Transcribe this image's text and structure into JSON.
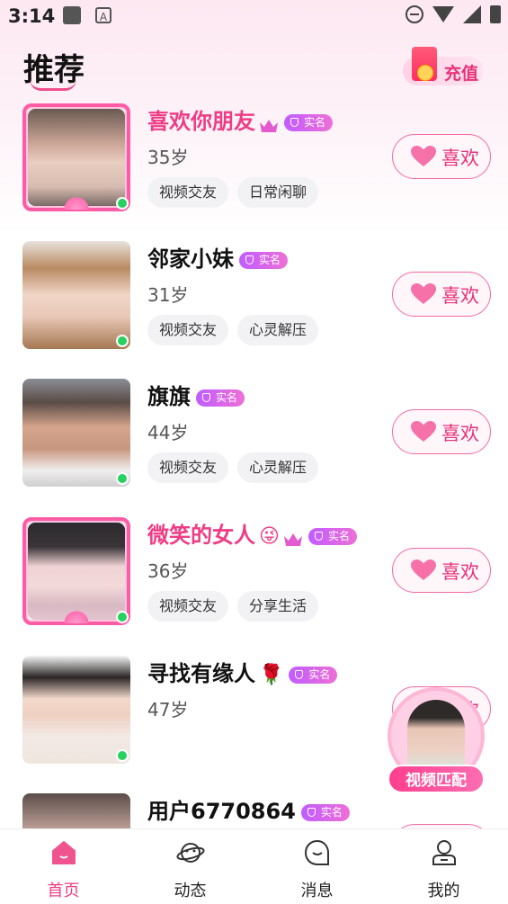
{
  "status_bar": {
    "time": "3:14",
    "a_icon": "A"
  },
  "header": {
    "title": "推荐",
    "recharge_label": "充值"
  },
  "users": [
    {
      "name": "喜欢你朋友",
      "vip": true,
      "badge": "实名",
      "age": "35岁",
      "tags": [
        "视频交友",
        "日常闲聊"
      ],
      "like_label": "喜欢",
      "extra_icon": "crown-icon"
    },
    {
      "name": "邻家小妹",
      "vip": false,
      "badge": "实名",
      "age": "31岁",
      "tags": [
        "视频交友",
        "心灵解压"
      ],
      "like_label": "喜欢"
    },
    {
      "name": "旗旗",
      "vip": false,
      "badge": "实名",
      "age": "44岁",
      "tags": [
        "视频交友",
        "心灵解压"
      ],
      "like_label": "喜欢"
    },
    {
      "name": "微笑的女人",
      "vip": true,
      "badge": "实名",
      "age": "36岁",
      "tags": [
        "视频交友",
        "分享生活"
      ],
      "like_label": "喜欢",
      "emoji": "😜"
    },
    {
      "name": "寻找有缘人",
      "vip": false,
      "badge": "实名",
      "age": "47岁",
      "tags": [],
      "like_label": "喜欢",
      "emoji": "🌹"
    },
    {
      "name": "用户6770864",
      "vip": false,
      "badge": "实名"
    }
  ],
  "video_match": {
    "label": "视频匹配"
  },
  "tab_bar": {
    "items": [
      {
        "label": "首页",
        "icon": "home-icon",
        "active": true
      },
      {
        "label": "动态",
        "icon": "planet-icon",
        "active": false
      },
      {
        "label": "消息",
        "icon": "message-icon",
        "active": false
      },
      {
        "label": "我的",
        "icon": "profile-icon",
        "active": false
      }
    ]
  },
  "colors": {
    "accent": "#ef3c84",
    "online": "#26d160",
    "verify": "#c05cff"
  }
}
